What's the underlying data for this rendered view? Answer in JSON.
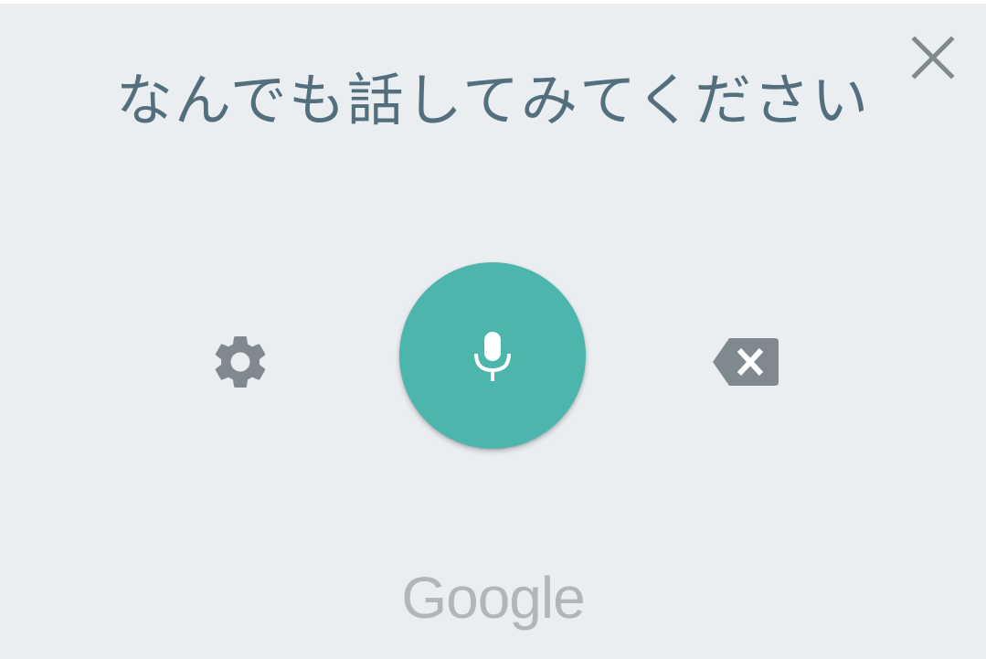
{
  "dialog": {
    "prompt": "なんでも話してみてください",
    "brand": "Google"
  },
  "icons": {
    "close": "close-icon",
    "settings": "gear-icon",
    "mic": "microphone-icon",
    "backspace": "backspace-icon"
  },
  "colors": {
    "background": "#eaeef1",
    "prompt_text": "#536e7c",
    "mic_button": "#4db6ac",
    "icon_gray": "#808a8e",
    "brand_gray": "#b3b6b8"
  }
}
